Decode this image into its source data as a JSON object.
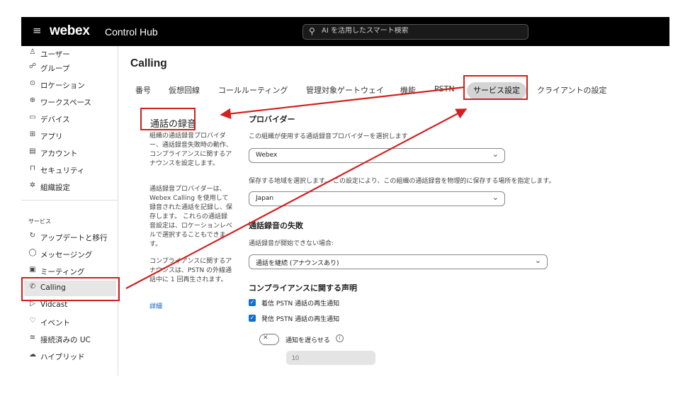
{
  "topbar": {
    "menu_icon": "hamburger-icon",
    "brand": "webex",
    "product": "Control Hub",
    "search_placeholder": "AI を活用したスマート検索"
  },
  "sidebar": {
    "items": [
      {
        "icon": "user-icon",
        "glyph": "♙",
        "label": "ユーザー"
      },
      {
        "icon": "group-icon",
        "glyph": "☍",
        "label": "グループ"
      },
      {
        "icon": "location-icon",
        "glyph": "⊙",
        "label": "ロケーション"
      },
      {
        "icon": "workspace-icon",
        "glyph": "⊕",
        "label": "ワークスペース"
      },
      {
        "icon": "device-icon",
        "glyph": "▭",
        "label": "デバイス"
      },
      {
        "icon": "apps-icon",
        "glyph": "⊞",
        "label": "アプリ"
      },
      {
        "icon": "account-icon",
        "glyph": "▤",
        "label": "アカウント"
      },
      {
        "icon": "lock-icon",
        "glyph": "⊓",
        "label": "セキュリティ"
      },
      {
        "icon": "gear-icon",
        "glyph": "✲",
        "label": "組織設定"
      }
    ],
    "section_label": "サービス",
    "service_items": [
      {
        "icon": "refresh-icon",
        "glyph": "↻",
        "label": "アップデートと移行"
      },
      {
        "icon": "chat-icon",
        "glyph": "◯",
        "label": "メッセージング"
      },
      {
        "icon": "calendar-icon",
        "glyph": "▣",
        "label": "ミーティング"
      },
      {
        "icon": "phone-icon",
        "glyph": "✆",
        "label": "Calling"
      },
      {
        "icon": "play-icon",
        "glyph": "▷",
        "label": "Vidcast"
      },
      {
        "icon": "event-icon",
        "glyph": "♡",
        "label": "イベント"
      },
      {
        "icon": "stack-icon",
        "glyph": "≋",
        "label": "接続済みの UC"
      },
      {
        "icon": "cloud-icon",
        "glyph": "☁",
        "label": "ハイブリッド"
      }
    ]
  },
  "main": {
    "title": "Calling",
    "tabs": [
      "番号",
      "仮想回線",
      "コールルーティング",
      "管理対象ゲートウェイ",
      "機能",
      "PSTN",
      "サービス設定",
      "クライアントの設定"
    ],
    "selected_tab": "サービス設定",
    "section_heading": "通話の録音",
    "desc1": "組織の通話録音プロバイダー、通話録音失敗時の動作、コンプライアンスに関するアナウンスを設定します。",
    "desc2": "通話録音プロバイダーは、Webex Calling を使用して録音された通話を記録し、保存します。 これらの通話録音設定は、ロケーションレベルで選択することもできます。",
    "desc3": "コンプライアンスに関するアナウンスは、PSTN の外線通話中に 1 回再生されます。",
    "details_link": "詳細",
    "provider_heading": "プロバイダー",
    "provider_label": "この組織が使用する通話録音プロバイダーを選択します",
    "provider_value": "Webex",
    "region_label": "保存する地域を選択します。 この設定により、この組織の通話録音を物理的に保存する場所を指定します。",
    "region_value": "Japan",
    "failure_heading": "通話録音の失敗",
    "failure_label": "通話録音が開始できない場合:",
    "failure_value": "通話を継続 (アナウンスあり)",
    "compliance_heading": "コンプライアンスに関する声明",
    "inbound_label": "着信 PSTN 通話の再生通知",
    "inbound_checked": true,
    "outbound_label": "発信 PSTN 通話の再生通知",
    "outbound_checked": true,
    "delay_label": "通知を遅らせる",
    "delay_toggle": "off",
    "delay_value": "10"
  },
  "annotation_color": "#d31f1f"
}
